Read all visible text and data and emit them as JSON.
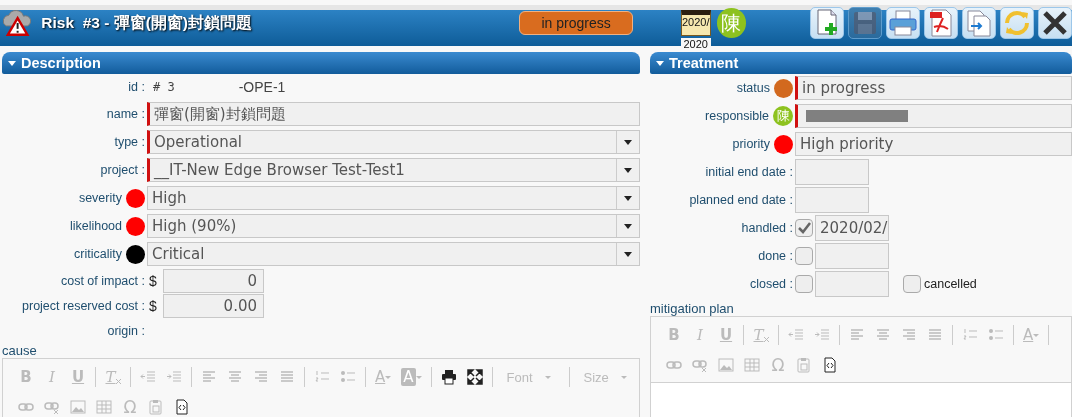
{
  "header": {
    "title": "Risk  #3 - 彈窗(開窗)封鎖問題",
    "status_badge": {
      "label": "in progress",
      "color": "#d96c1f"
    },
    "calendar": {
      "lines": [
        "2020/",
        "2020"
      ]
    },
    "avatar": {
      "initial": "陳",
      "color": "#8dc21f"
    },
    "toolbar": [
      {
        "kind": "new",
        "disabled": false
      },
      {
        "kind": "save",
        "disabled": true
      },
      {
        "kind": "print",
        "disabled": false
      },
      {
        "kind": "pdf",
        "disabled": false
      },
      {
        "kind": "copy",
        "disabled": false
      },
      {
        "kind": "refresh",
        "disabled": false
      },
      {
        "kind": "close",
        "disabled": false
      }
    ]
  },
  "description": {
    "title": "Description",
    "fields": [
      {
        "kind": "id",
        "label": "id :",
        "number": "# 3",
        "reference": "-OPE-1"
      },
      {
        "kind": "text",
        "label": "name :",
        "value": "彈窗(開窗)封鎖問題",
        "required": true
      },
      {
        "kind": "select",
        "label": "type :",
        "value": "Operational",
        "required": true
      },
      {
        "kind": "select",
        "label": "project :",
        "value": "__IT-New Edge Browser Test-Test1",
        "required": true
      },
      {
        "kind": "colored_select",
        "label": "severity",
        "color": "#ff0000",
        "value": "High"
      },
      {
        "kind": "colored_select",
        "label": "likelihood",
        "color": "#ff0000",
        "value": "High (90%)"
      },
      {
        "kind": "colored_select",
        "label": "criticality",
        "color": "#000000",
        "value": "Critical"
      },
      {
        "kind": "cost",
        "label": "cost of impact :",
        "currency": "$",
        "value": "0"
      },
      {
        "kind": "cost",
        "label": "project reserved cost :",
        "currency": "$",
        "value": "0.00"
      },
      {
        "kind": "empty",
        "label": "origin :"
      }
    ],
    "editor": {
      "label": "cause",
      "rows": [
        {
          "groups": [
            {
              "items": [
                {
                  "kind": "bold",
                  "text": "B",
                  "disabled": true
                },
                {
                  "kind": "italic",
                  "text": "I",
                  "disabled": true
                },
                {
                  "kind": "underline",
                  "text": "U",
                  "disabled": true
                }
              ]
            },
            {
              "items": [
                {
                  "kind": "removeformat",
                  "text": "T",
                  "disabled": true
                }
              ]
            },
            {
              "items": [
                {
                  "kind": "outdent",
                  "disabled": true
                },
                {
                  "kind": "indent",
                  "disabled": true
                }
              ]
            },
            {
              "items": [
                {
                  "kind": "alignleft",
                  "disabled": true
                },
                {
                  "kind": "aligncenter",
                  "disabled": true
                },
                {
                  "kind": "alignright",
                  "disabled": true
                },
                {
                  "kind": "justify",
                  "disabled": true
                }
              ]
            },
            {
              "items": [
                {
                  "kind": "numlist",
                  "disabled": true
                },
                {
                  "kind": "bullist",
                  "disabled": true
                }
              ]
            },
            {
              "items": [
                {
                  "kind": "textcolor",
                  "text": "A",
                  "disabled": true
                },
                {
                  "kind": "bgcolor",
                  "text": "A",
                  "disabled": true
                }
              ]
            },
            {
              "items": [
                {
                  "kind": "print",
                  "disabled": false
                },
                {
                  "kind": "maximize",
                  "disabled": false
                }
              ]
            },
            {
              "items": [
                {
                  "kind": "combo",
                  "text": "Font",
                  "disabled": true
                }
              ]
            },
            {
              "items": [
                {
                  "kind": "combo",
                  "text": "Size",
                  "disabled": true
                }
              ]
            }
          ]
        },
        {
          "groups": [
            {
              "items": [
                {
                  "kind": "link",
                  "disabled": true
                },
                {
                  "kind": "unlink",
                  "disabled": true
                },
                {
                  "kind": "image",
                  "disabled": true
                },
                {
                  "kind": "table",
                  "disabled": true
                },
                {
                  "kind": "specialchar",
                  "text": "Ω",
                  "disabled": true
                },
                {
                  "kind": "pasteword",
                  "disabled": true
                },
                {
                  "kind": "source",
                  "disabled": false
                }
              ]
            }
          ]
        }
      ]
    }
  },
  "treatment": {
    "title": "Treatment",
    "fields": [
      {
        "kind": "colored_select",
        "label": "status",
        "color": "#d2691e",
        "value": "in progress",
        "required": true
      },
      {
        "kind": "avatar_select",
        "label": "responsible",
        "initial": "陳",
        "color": "#8dc21f",
        "value_hidden": true,
        "required": true
      },
      {
        "kind": "colored_select",
        "label": "priority",
        "color": "#ff0000",
        "value": "High priority",
        "required": false
      },
      {
        "kind": "date",
        "label": "initial end date :"
      },
      {
        "kind": "date",
        "label": "planned end date :"
      },
      {
        "kind": "check_date",
        "label": "handled :",
        "checked": true,
        "value": "2020/02/"
      },
      {
        "kind": "check_date",
        "label": "done :",
        "checked": false
      },
      {
        "kind": "check_date",
        "label": "closed :",
        "checked": false,
        "extra": {
          "label": "cancelled",
          "checked": false
        }
      }
    ],
    "editor": {
      "label": "mitigation plan",
      "rows": [
        {
          "groups": [
            {
              "items": [
                {
                  "kind": "bold",
                  "text": "B",
                  "disabled": true
                },
                {
                  "kind": "italic",
                  "text": "I",
                  "disabled": true
                },
                {
                  "kind": "underline",
                  "text": "U",
                  "disabled": true
                }
              ]
            },
            {
              "items": [
                {
                  "kind": "removeformat",
                  "text": "T",
                  "disabled": true
                }
              ]
            },
            {
              "items": [
                {
                  "kind": "outdent",
                  "disabled": true
                },
                {
                  "kind": "indent",
                  "disabled": true
                }
              ]
            },
            {
              "items": [
                {
                  "kind": "alignleft",
                  "disabled": true
                },
                {
                  "kind": "aligncenter",
                  "disabled": true
                },
                {
                  "kind": "alignright",
                  "disabled": true
                },
                {
                  "kind": "justify",
                  "disabled": true
                }
              ]
            },
            {
              "items": [
                {
                  "kind": "numlist",
                  "disabled": true
                },
                {
                  "kind": "bullist",
                  "disabled": true
                }
              ]
            },
            {
              "items": [
                {
                  "kind": "textcolor",
                  "text": "A",
                  "disabled": true
                }
              ]
            }
          ]
        },
        {
          "groups": [
            {
              "items": [
                {
                  "kind": "link",
                  "disabled": true
                },
                {
                  "kind": "unlink",
                  "disabled": true
                },
                {
                  "kind": "image",
                  "disabled": true
                },
                {
                  "kind": "table",
                  "disabled": true
                },
                {
                  "kind": "specialchar",
                  "text": "Ω",
                  "disabled": true
                },
                {
                  "kind": "pasteword",
                  "disabled": true
                },
                {
                  "kind": "source",
                  "disabled": false
                }
              ]
            }
          ]
        }
      ],
      "content": true
    }
  }
}
